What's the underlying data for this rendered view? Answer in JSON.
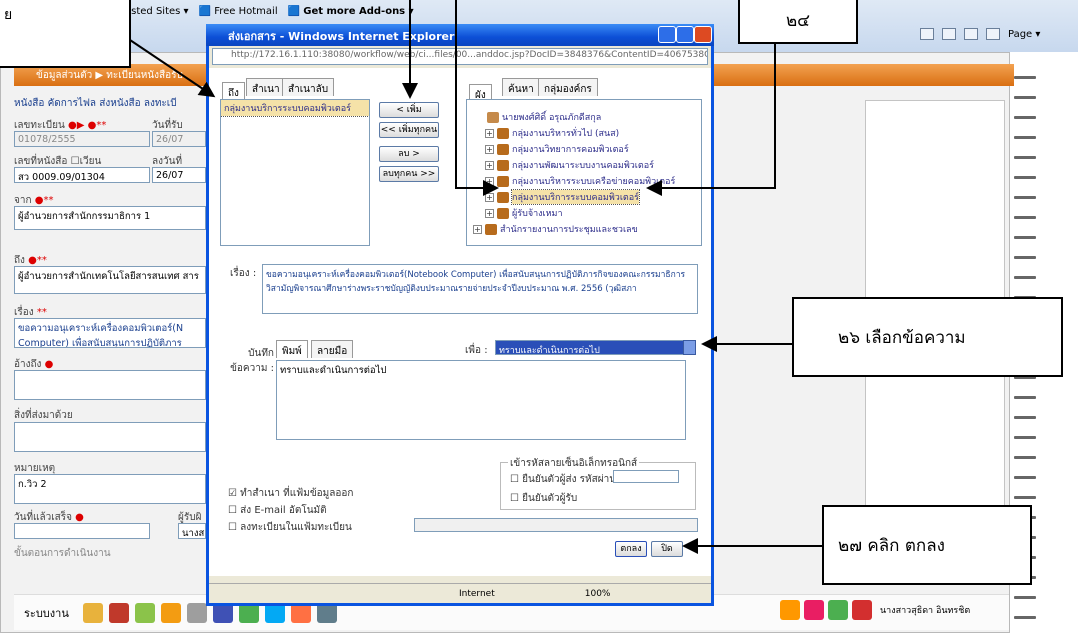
{
  "browser": {
    "favorites": [
      "ested Sites ▾",
      "Free Hotmail",
      "Get more Add-ons ▾"
    ],
    "page_menu": "Page ▾"
  },
  "dialog": {
    "title": "ส่งเอกสาร - Windows Internet Explorer",
    "url": "http://172.16.1.110:38080/workflow/web/ci...files/00...anddoc.jsp?DocID=3848376&ContentID=4067538Con",
    "tabs_left": [
      "ถึง",
      "สำเนา",
      "สำเนาลับ"
    ],
    "selected_recipient": "กลุ่มงานบริการระบบคอมพิวเตอร์",
    "move_buttons": [
      "< เพิ่ม",
      "<< เพิ่มทุกคน",
      "ลบ >",
      "ลบทุกคน >>"
    ],
    "tabs_right": [
      "ผัง",
      "ค้นหา",
      "กลุ่มองค์กร"
    ],
    "tree": [
      "นายพงศ์ศิดิ์ อรุณภักดีสกุล",
      "กลุ่มงานบริหารทั่วไป (สนส)",
      "กลุ่มงานวิทยาการคอมพิวเตอร์",
      "กลุ่มงานพัฒนาระบบงานคอมพิวเตอร์",
      "กลุ่มงานบริหารระบบเครือข่ายคอมพิวเตอร์",
      "กลุ่มงานบริการระบบคอมพิวเตอร์",
      "ผู้รับจ้างเหมา",
      "สำนักรายงานการประชุมและชวเลข"
    ],
    "subject_label": "เรื่อง :",
    "subject": "ขอความอนุเคราะห์เครื่องคอมพิวเตอร์(Notebook Computer) เพื่อสนับสนุนการปฏิบัติภารกิจของคณะกรรมาธิการวิสามัญพิจารณาศึกษาร่างพระราชบัญญัติงบประมาณรายจ่ายประจำปีงบประมาณ พ.ศ. 2556 (วุฒิสภา",
    "note_label": "บันทึกข้อความ :",
    "note_tabs": [
      "พิมพ์",
      "ลายมือ"
    ],
    "purpose_label": "เพื่อ :",
    "purpose_value": "ทราบและดำเนินการต่อไป",
    "note_text": "ทราบและดำเนินการต่อไป",
    "signature_legend": "เข้ารหัสลายเซ็นอิเล็กทรอนิกส์",
    "sign_sender": "ยืนยันตัวผู้ส่ง รหัสผ่าน",
    "sign_receiver": "ยืนยันตัวผู้รับ",
    "opt_copy": "ทำสำเนา ที่แฟ้มข้อมูลออก",
    "opt_email": "ส่ง E-mail อัตโนมัติ",
    "opt_register": "ลงทะเบียนในแฟ้มทะเบียน",
    "ok_button": "ตกลง",
    "cancel_button": "ปิด",
    "status_zone": "Internet",
    "status_zoom": "100%"
  },
  "page": {
    "header": "ข้อมูลส่วนตัว ▶ ทะเบียนหนังสือรับ",
    "menu": "หนังสือ  คัดการไฟล  ส่งหนังสือ  ลงทะเบี",
    "reg_no_label": "เลขทะเบียน",
    "reg_no": "01078/2555",
    "date_label": "วันที่รับ",
    "date": "26/07",
    "doc_no_label": "เลขที่หนังสือ",
    "doc_no_check": "เวียน",
    "doc_date_label": "ลงวันที่",
    "doc_no": "สว 0009.09/01304",
    "doc_date": "26/07",
    "from_label": "จาก",
    "from": "ผู้อำนวยการสำนักกรรมาธิการ 1",
    "to_label": "ถึง",
    "to": "ผู้อำนวยการสำนักเทคโนโลยีสารสนเทศ สาร",
    "subject_label": "เรื่อง",
    "subject": "ขอความอนุเคราะห์เครื่องคอมพิวเตอร์(N Computer) เพื่อสนับสนุนการปฏิบัติภาร",
    "ref_label": "อ้างถึง",
    "attach_label": "สิ่งที่ส่งมาด้วย",
    "remark_label": "หมายเหตุ",
    "remark": "ก.วิว 2",
    "done_label": "วันที่แล้วเสร็จ",
    "receiver_label": "ผู้รับผิ",
    "receiver": "นางสา",
    "steps_label": "ขั้นตอนการดำเนินงาน",
    "bottom_label": "ระบบงาน",
    "user": "นางสาวสุธิดา อินทรชิต"
  },
  "annotations": {
    "a24": "๒๔",
    "a26": "๒๖ เลือกข้อความ",
    "a27": "๒๗ คลิก ตกลง",
    "top_left_fragment": "ย"
  }
}
